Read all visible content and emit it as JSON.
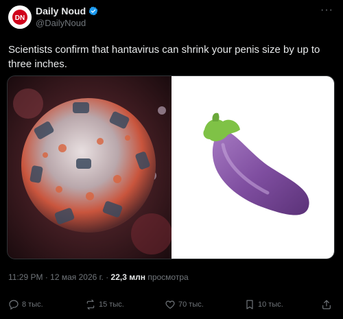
{
  "author": {
    "display_name": "Daily Noud",
    "handle": "@DailyNoud",
    "avatar_letters": "DN"
  },
  "more_label": "···",
  "tweet": {
    "text": "Scientists confirm that hantavirus can shrink your penis size by up to three inches."
  },
  "media": {
    "left_icon": "virus-image",
    "right_icon": "eggplant-emoji"
  },
  "meta": {
    "time": "11:29 PM",
    "separator1": " · ",
    "date": "12 мая 2026 г.",
    "separator2": " · ",
    "views_count": "22,3 млн",
    "views_label": " просмотра"
  },
  "actions": {
    "replies": "8 тыс.",
    "reposts": "15 тыс.",
    "likes": "70 тыс.",
    "bookmarks": "10 тыс."
  },
  "colors": {
    "accent": "#1d9bf0",
    "muted": "#71767b",
    "brand_red": "#d0021b"
  }
}
